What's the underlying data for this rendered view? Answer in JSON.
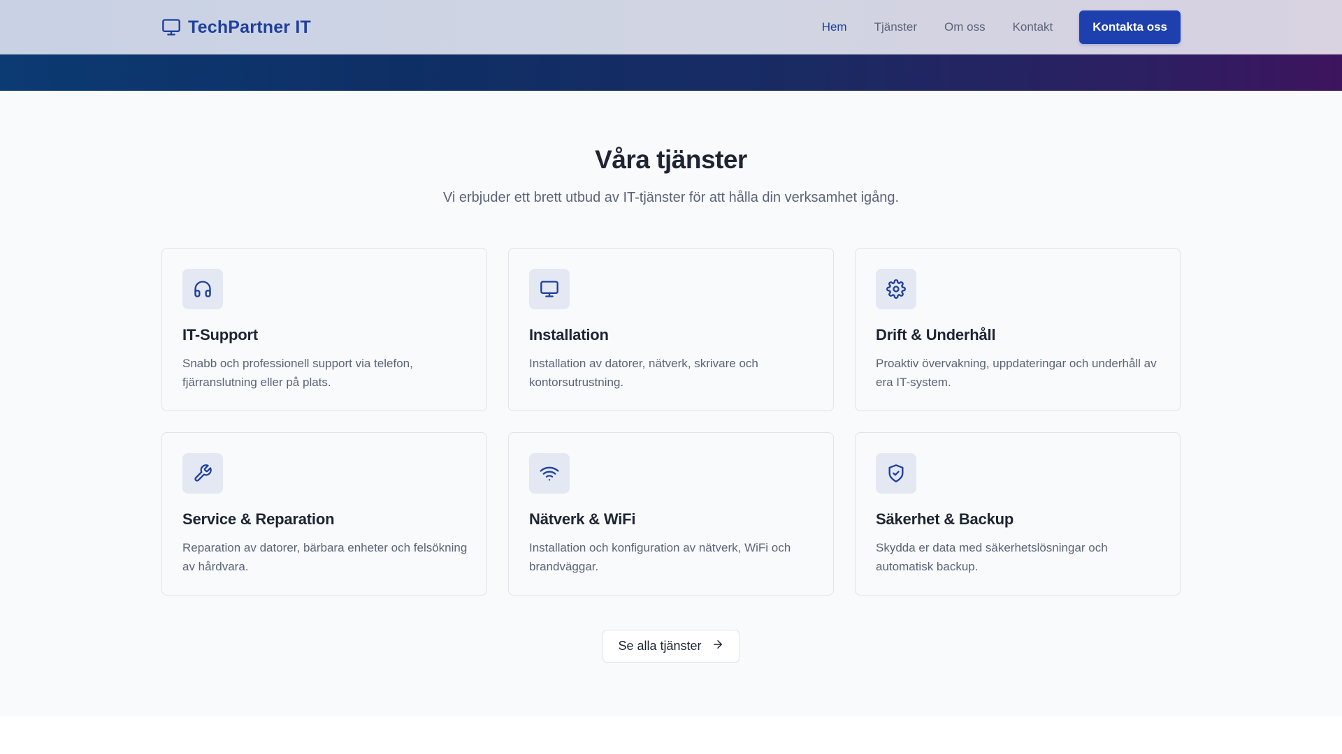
{
  "header": {
    "brand": "TechPartner IT",
    "brand_icon": "monitor-icon",
    "nav": [
      {
        "label": "Hem",
        "active": true
      },
      {
        "label": "Tjänster",
        "active": false
      },
      {
        "label": "Om oss",
        "active": false
      },
      {
        "label": "Kontakt",
        "active": false
      }
    ],
    "cta_label": "Kontakta oss"
  },
  "services": {
    "title": "Våra tjänster",
    "subtitle": "Vi erbjuder ett brett utbud av IT-tjänster för att hålla din verksamhet igång.",
    "cards": [
      {
        "icon": "headphones-icon",
        "title": "IT-Support",
        "desc": "Snabb och professionell support via telefon, fjärranslutning eller på plats."
      },
      {
        "icon": "monitor-icon",
        "title": "Installation",
        "desc": "Installation av datorer, nätverk, skrivare och kontorsutrustning."
      },
      {
        "icon": "gear-icon",
        "title": "Drift & Underhåll",
        "desc": "Proaktiv övervakning, uppdateringar och underhåll av era IT-system."
      },
      {
        "icon": "wrench-icon",
        "title": "Service & Reparation",
        "desc": "Reparation av datorer, bärbara enheter och felsökning av hårdvara."
      },
      {
        "icon": "wifi-icon",
        "title": "Nätverk & WiFi",
        "desc": "Installation och konfiguration av nätverk, WiFi och brandväggar."
      },
      {
        "icon": "shield-check-icon",
        "title": "Säkerhet & Backup",
        "desc": "Skydda er data med säkerhetslösningar och automatisk backup."
      }
    ],
    "all_label": "Se alla tjänster",
    "all_icon": "arrow-right-icon"
  },
  "colors": {
    "brand": "#1f3f9e",
    "cta": "#1e40af",
    "band_start": "#0c3a72",
    "band_end": "#3d145e"
  }
}
